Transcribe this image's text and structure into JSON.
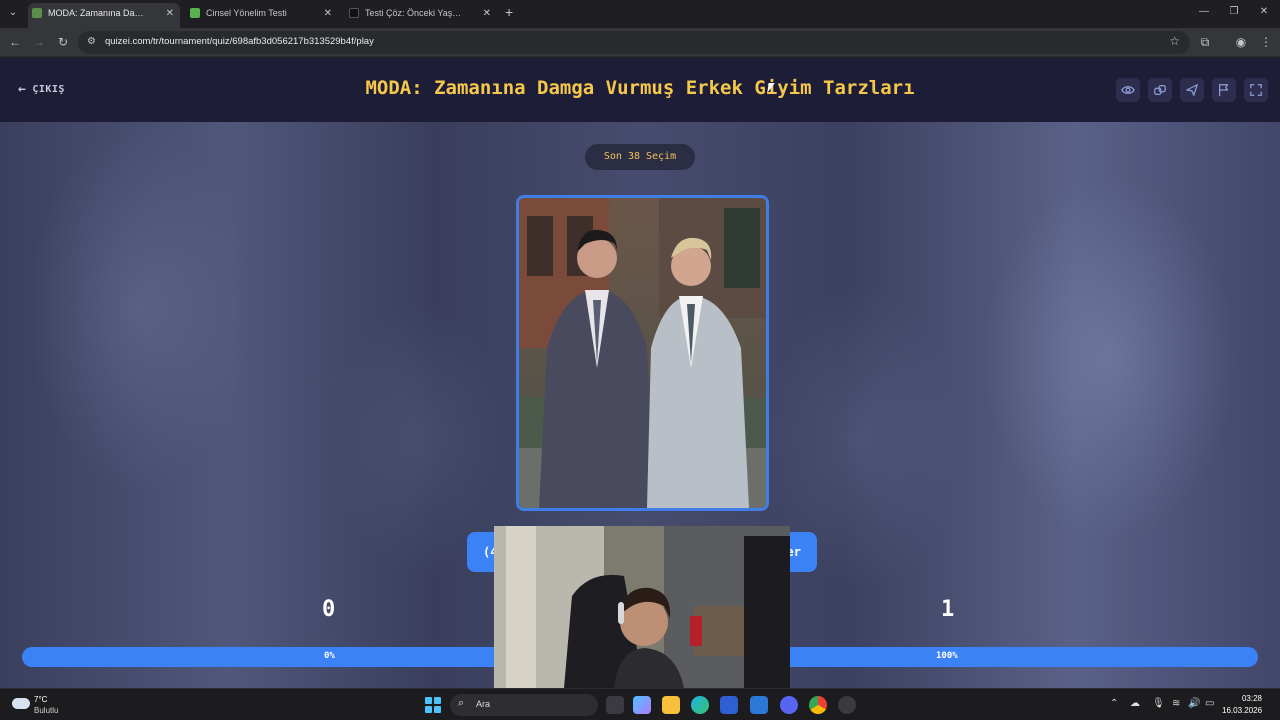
{
  "browser": {
    "tabs": [
      {
        "title": "MODA: Zamanına Damga Vurmuş Erkek Giyim Tarzları",
        "active": true,
        "favicon_color": "#5a8f4b"
      },
      {
        "title": "Cinsel Yönelim Testi",
        "active": false,
        "favicon_color": "#59b34a"
      },
      {
        "title": "Testi Çöz: Önceki Yaşamındaki Cinsel Yönelim",
        "active": false,
        "favicon_color": "#111111"
      }
    ],
    "url": "quizei.com/tr/tournament/quiz/698afb3d056217b313529b4f/play"
  },
  "header": {
    "exit_label": "ÇIKIŞ",
    "title": "MODA: Zamanına Damga Vurmuş Erkek Giyim Tarzları",
    "icons": [
      "eye-icon",
      "link-icon",
      "send-icon",
      "flag-icon",
      "fullscreen-icon"
    ]
  },
  "round": {
    "label": "Son 38 Seçim"
  },
  "choose_button": {
    "left_fragment": "(4",
    "right_fragment": "er"
  },
  "scores": {
    "left": "0",
    "right": "1",
    "left_percent_label": "0%",
    "right_percent_label": "100%",
    "left_fraction": 0.0
  },
  "taskbar": {
    "weather_temp": "7°C",
    "weather_desc": "Bulutlu",
    "search_placeholder": "Ara",
    "time": "03:28",
    "date": "16.03.2026"
  },
  "colors": {
    "accent": "#3b82f6",
    "title": "#f5c84a",
    "header_bg": "#1e1d38"
  }
}
